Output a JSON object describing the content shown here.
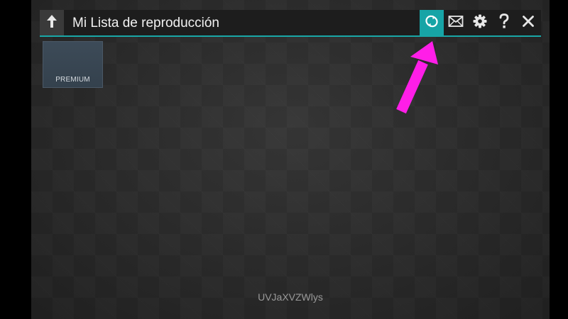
{
  "header": {
    "title": "Mi Lista de reproducción",
    "back_icon": "back-arrow-icon",
    "actions": [
      {
        "name": "refresh",
        "icon": "refresh-icon",
        "active": true
      },
      {
        "name": "messages",
        "icon": "envelope-icon",
        "active": false
      },
      {
        "name": "settings",
        "icon": "gear-icon",
        "active": false
      },
      {
        "name": "help",
        "icon": "question-icon",
        "active": false
      },
      {
        "name": "close",
        "icon": "close-icon",
        "active": false
      }
    ],
    "accent_color": "#17a4a6"
  },
  "tiles": [
    {
      "label": "PREMIUM"
    }
  ],
  "footer": {
    "code": "UVJaXVZWlys"
  },
  "annotation": {
    "type": "pointer-arrow",
    "color": "#ff1ee8",
    "target": "refresh-button"
  }
}
